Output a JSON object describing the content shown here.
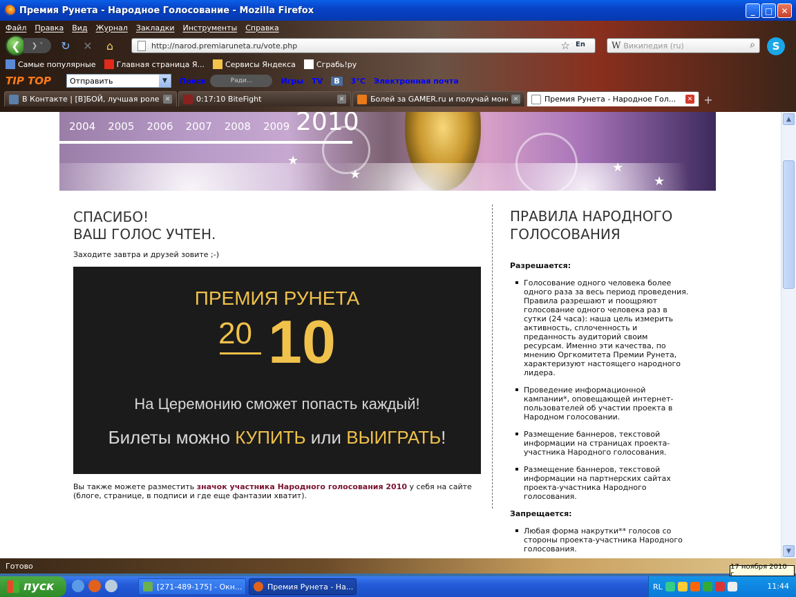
{
  "window": {
    "title": "Премия Рунета - Народное Голосование - Mozilla Firefox"
  },
  "menu": [
    "Файл",
    "Правка",
    "Вид",
    "Журнал",
    "Закладки",
    "Инструменты",
    "Справка"
  ],
  "navigation": {
    "url": "http://narod.premiaruneta.ru/vote.php",
    "lang": "En",
    "search_placeholder": "Википедия (ru)",
    "search_engine_glyph": "W"
  },
  "bookmarks": [
    "Самые популярные",
    "Главная страница Я...",
    "Сервисы Яндекса",
    "Сграбь!ру"
  ],
  "toolbar2": {
    "logo": "TIP TOP",
    "send_select": "Отправить",
    "search_label": "Поиск",
    "radio_label": "Ради...",
    "games": "Игры",
    "tv": "TV",
    "vk": "В",
    "weather": "3°C",
    "email": "Электронная почта"
  },
  "tabs": [
    {
      "label": "В Контакте | [В]БОЙ, лучшая ролева...",
      "active": false
    },
    {
      "label": "0:17:10 BiteFight",
      "active": false
    },
    {
      "label": "Болей за GAMER.ru и получай монет...",
      "active": false
    },
    {
      "label": "Премия Рунета - Народное Гол...",
      "active": true
    }
  ],
  "banner": {
    "years": [
      "2004",
      "2005",
      "2006",
      "2007",
      "2008",
      "2009"
    ],
    "current_year": "2010"
  },
  "main": {
    "thanks_line1": "СПАСИБО!",
    "thanks_line2": "ВАШ ГОЛОС УЧТЕН.",
    "subtitle": "Заходите завтра и друзей зовите ;-)",
    "promo": {
      "title": "ПРЕМИЯ РУНЕТА",
      "year_left": "20",
      "year_right": "10",
      "line1": "На Церемонию сможет попасть каждый!",
      "line2_a": "Билеты можно ",
      "line2_buy": "КУПИТЬ",
      "line2_b": " или ",
      "line2_win": "ВЫИГРАТЬ",
      "line2_c": "!"
    },
    "badge_prefix": "Вы также можете разместить ",
    "badge_link": "значок участника Народного голосования 2010",
    "badge_suffix": " у себя на сайте (блоге, странице, в подписи и где еще фантазии хватит)."
  },
  "rules": {
    "title": "ПРАВИЛА НАРОДНОГО ГОЛОСОВАНИЯ",
    "allowed_heading": "Разрешается:",
    "allowed": [
      "Голосование одного человека более одного раза за весь период проведения. Правила разрешают и поощряют голосование одного человека раз в сутки (24 часа): наша цель измерить активность, сплоченность и преданность аудиторий своим ресурсам. Именно эти качества, по мнению Оргкомитета Премии Рунета, характеризуют настоящего народного лидера.",
      "Проведение информационной кампании*, оповещающей интернет-пользователей об участии проекта в Народном голосовании.",
      "Размещение баннеров, текстовой информации на страницах проекта-участника Народного голосования.",
      "Размещение баннеров, текстовой информации на партнерских сайтах проекта-участника Народного голосования."
    ],
    "forbidden_heading": "Запрещается:",
    "forbidden": [
      "Любая форма накрутки** голосов со стороны проекта-участника Народного голосования."
    ]
  },
  "status": "Готово",
  "taskbar": {
    "start": "пуск",
    "tasks": [
      "[271-489-175] - Окн...",
      "Премия Рунета - На..."
    ],
    "lang": "RL",
    "clock": "11:44",
    "tooltip": "17 ноября 2010 г."
  }
}
